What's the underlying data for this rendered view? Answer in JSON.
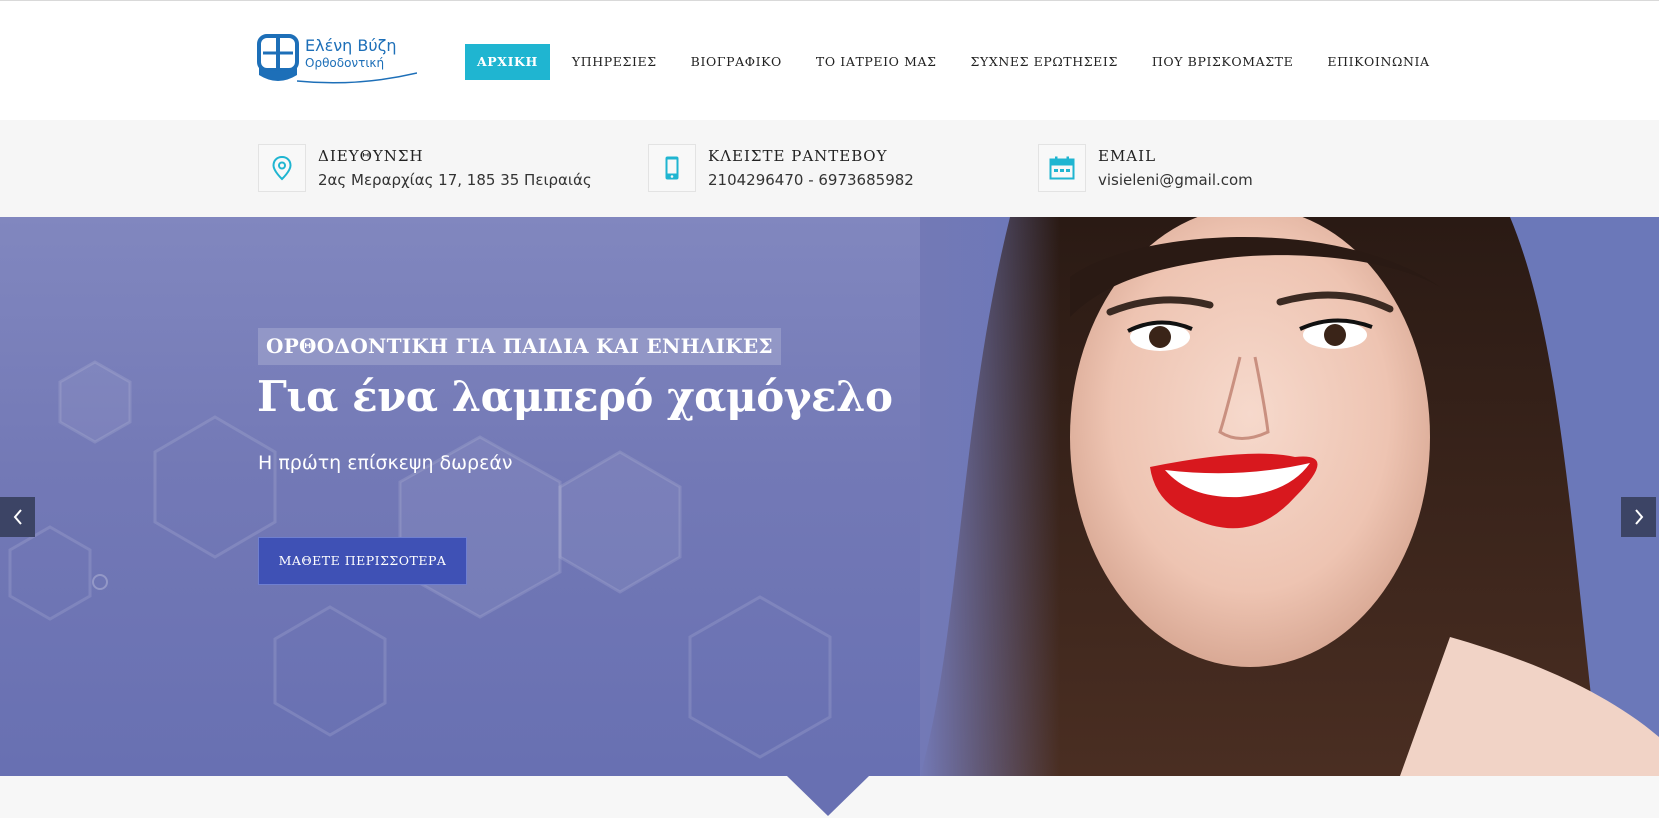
{
  "brand": {
    "name": "Ελένη Βύζη",
    "subtitle": "Ορθοδοντική",
    "color": "#1d6fb8"
  },
  "nav": {
    "items": [
      {
        "label": "ΑΡΧΙΚΗ",
        "active": true
      },
      {
        "label": "ΥΠΗΡΕΣΙΕΣ",
        "active": false
      },
      {
        "label": "ΒΙΟΓΡΑΦΙΚΟ",
        "active": false
      },
      {
        "label": "ΤΟ ΙΑΤΡΕΙΟ ΜΑΣ",
        "active": false
      },
      {
        "label": "ΣΥΧΝΕΣ ΕΡΩΤΗΣΕΙΣ",
        "active": false
      },
      {
        "label": "ΠΟΥ ΒΡΙΣΚΟΜΑΣΤΕ",
        "active": false
      },
      {
        "label": "ΕΠΙΚΟΙΝΩΝΙΑ",
        "active": false
      }
    ],
    "active_color": "#1fb5d1"
  },
  "info": [
    {
      "icon": "map-pin-icon",
      "title": "ΔΙΕΥΘΥΝΣΗ",
      "value": "2ας Μεραρχίας 17, 185 35 Πειραιάς"
    },
    {
      "icon": "mobile-phone-icon",
      "title": "ΚΛΕΙΣΤΕ ΡΑΝΤΕΒΟΥ",
      "value": "2104296470 - 6973685982"
    },
    {
      "icon": "calendar-icon",
      "title": "EMAIL",
      "value": "visieleni@gmail.com"
    }
  ],
  "hero": {
    "eyebrow": "ΟΡΘΟΔΟΝΤΙΚΗ ΓΙΑ ΠΑΙΔΙΑ ΚΑΙ ΕΝΗΛΙΚΕΣ",
    "headline": "Για ένα λαμπερό χαμόγελο",
    "subline": "Η πρώτη επίσκεψη δωρεάν",
    "cta_label": "ΜΑΘΕΤΕ ΠΕΡΙΣΣΟΤΕΡΑ",
    "background_color": "#7379b6",
    "cta_color": "#3f51b5"
  },
  "icons": {
    "prev": "chevron-left-icon",
    "next": "chevron-right-icon"
  }
}
